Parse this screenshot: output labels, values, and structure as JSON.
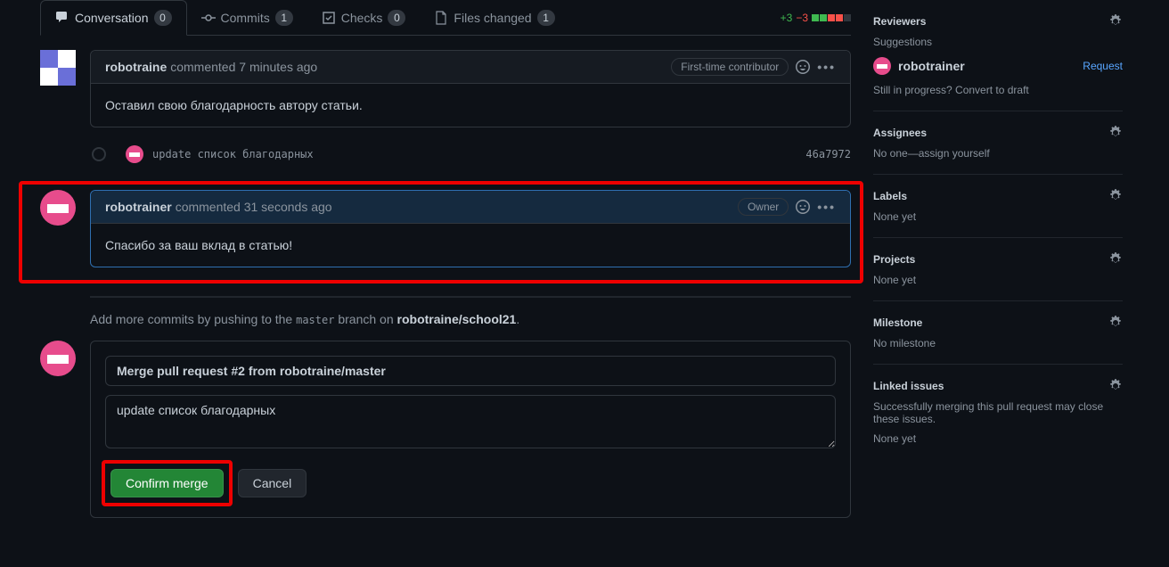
{
  "tabs": {
    "conversation": {
      "label": "Conversation",
      "count": "0"
    },
    "commits": {
      "label": "Commits",
      "count": "1"
    },
    "checks": {
      "label": "Checks",
      "count": "0"
    },
    "files": {
      "label": "Files changed",
      "count": "1"
    }
  },
  "diff": {
    "add": "+3",
    "del": "−3"
  },
  "comment1": {
    "author": "robotraine",
    "meta": "commented 7 minutes ago",
    "badge": "First-time contributor",
    "body": "Оставил свою благодарность автору статьи."
  },
  "commit": {
    "msg": "update список благодарных",
    "sha": "46a7972"
  },
  "comment2": {
    "author": "robotrainer",
    "meta": "commented 31 seconds ago",
    "badge": "Owner",
    "body": "Спасибо за ваш вклад в статью!"
  },
  "push_hint": {
    "pre": "Add more commits by pushing to the ",
    "branch": "master",
    "mid": " branch on ",
    "repo": "robotraine/school21",
    "end": "."
  },
  "merge": {
    "title": "Merge pull request #2 from robotraine/master",
    "desc": "update список благодарных",
    "confirm": "Confirm merge",
    "cancel": "Cancel"
  },
  "sidebar": {
    "reviewers": {
      "title": "Reviewers",
      "suggestions": "Suggestions",
      "name": "robotrainer",
      "request": "Request",
      "draft": "Still in progress? Convert to draft"
    },
    "assignees": {
      "title": "Assignees",
      "text": "No one—assign yourself"
    },
    "labels": {
      "title": "Labels",
      "text": "None yet"
    },
    "projects": {
      "title": "Projects",
      "text": "None yet"
    },
    "milestone": {
      "title": "Milestone",
      "text": "No milestone"
    },
    "linked": {
      "title": "Linked issues",
      "text": "Successfully merging this pull request may close these issues.",
      "none": "None yet"
    }
  }
}
